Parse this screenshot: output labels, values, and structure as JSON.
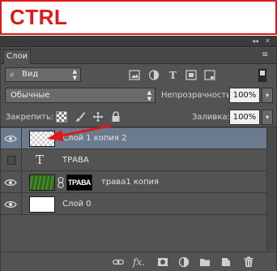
{
  "banner": {
    "text": "CTRL"
  },
  "panel": {
    "collapse_glyph": "◂◂",
    "close_glyph": "✕",
    "tab_label": "Слои",
    "menu_glyph": "≡",
    "filter": {
      "kind_label": "Вид",
      "icon": "search-icon"
    },
    "blend_mode": "Обычные",
    "opacity_label": "Непрозрачность:",
    "opacity_value": "100%",
    "lock_label": "Закрепить:",
    "fill_label": "Заливка:",
    "fill_value": "100%",
    "dropdown_glyph": "▾"
  },
  "layers": [
    {
      "name": "Слой 1 копия 2",
      "visible": true,
      "selected": true,
      "thumb": "transparent"
    },
    {
      "name": "ТРАВА",
      "visible": false,
      "selected": false,
      "thumb": "type"
    },
    {
      "name": "трава1 копия",
      "visible": true,
      "selected": false,
      "thumb": "grass",
      "mask_text": "ТРАВА"
    },
    {
      "name": "Слой 0",
      "visible": true,
      "selected": false,
      "thumb": "white"
    }
  ],
  "bottom_bar": {
    "fx_label": "fx."
  },
  "colors": {
    "accent": "#e01818",
    "panel_bg": "#535353",
    "selected_row": "#6c7a8e"
  }
}
